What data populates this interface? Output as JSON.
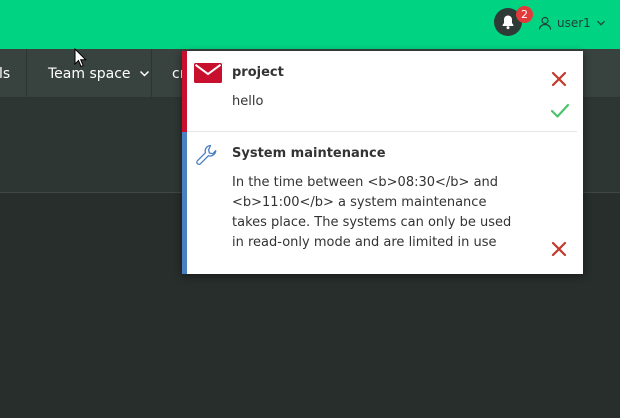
{
  "header": {
    "notification_count": "2",
    "username": "user1"
  },
  "nav": {
    "items": [
      {
        "label": "ls"
      },
      {
        "label": "Team space"
      },
      {
        "label": "cr"
      }
    ]
  },
  "notifications": [
    {
      "type": "message",
      "icon": "envelope-icon",
      "accent_color": "#c8102e",
      "title": "project",
      "body": "hello",
      "actions": [
        "dismiss",
        "mark-read"
      ]
    },
    {
      "type": "maintenance",
      "icon": "wrench-icon",
      "accent_color": "#4a7fc1",
      "title": "System maintenance",
      "body": "In the time between <b>08:30</b> and <b>11:00</b> a system maintenance takes place. The systems can only be used in read-only mode and are limited in use",
      "actions": [
        "dismiss"
      ]
    }
  ],
  "colors": {
    "topbar": "#00d483",
    "navbar": "#38423f",
    "background": "#282e2c",
    "dismiss": "#c0392b",
    "confirm": "#4cc36b"
  }
}
